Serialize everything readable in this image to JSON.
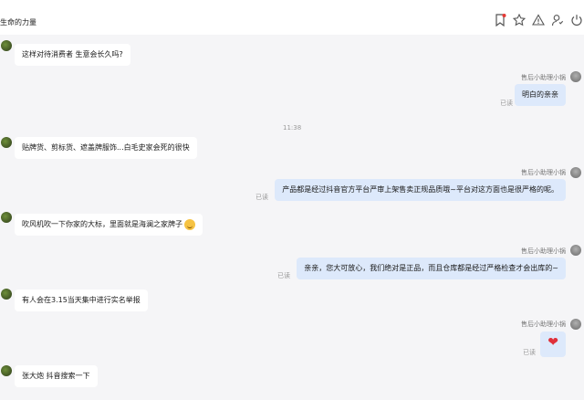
{
  "window": {
    "title": "生命的力量"
  },
  "toolbar": {
    "icons": [
      "bookmark-flag-icon",
      "star-icon",
      "warning-icon",
      "user-icon",
      "power-icon"
    ],
    "notify_color": "#e53935"
  },
  "messages": [
    {
      "side": "left",
      "text": "这样对待消费者 生意会长久吗?"
    },
    {
      "side": "right",
      "sender": "售后小助理小锅",
      "read": "已读",
      "text": "明白的亲亲"
    },
    {
      "side": "time",
      "text": "11:38"
    },
    {
      "side": "left",
      "text": "贴牌货、剪标货、遮盖牌服饰...白毛史家会死的很快"
    },
    {
      "side": "right",
      "sender": "售后小助理小锅",
      "read": "已读",
      "text": "产品都是经过抖音官方平台严审上架售卖正规品质哦~平台对这方面也是很严格的呢。"
    },
    {
      "side": "left",
      "text": "吹风机吹一下你家的大标，里面就是海澜之家牌子",
      "emoji": "rofl-emoji"
    },
    {
      "side": "right",
      "sender": "售后小助理小锅",
      "read": "已读",
      "text": "亲亲，您大可放心，我们绝对是正品，而且仓库都是经过严格检查才会出库的~"
    },
    {
      "side": "left",
      "text": "有人会在3.15当天集中进行实名举报"
    },
    {
      "side": "right",
      "sender": "售后小助理小锅",
      "read": "已读",
      "text": "",
      "heart": "❤"
    },
    {
      "side": "left",
      "text": "张大炮 抖音搜索一下"
    }
  ],
  "colors": {
    "bubble_right": "#dde9fb",
    "bubble_left": "#ffffff",
    "heart": "#e0303a"
  }
}
